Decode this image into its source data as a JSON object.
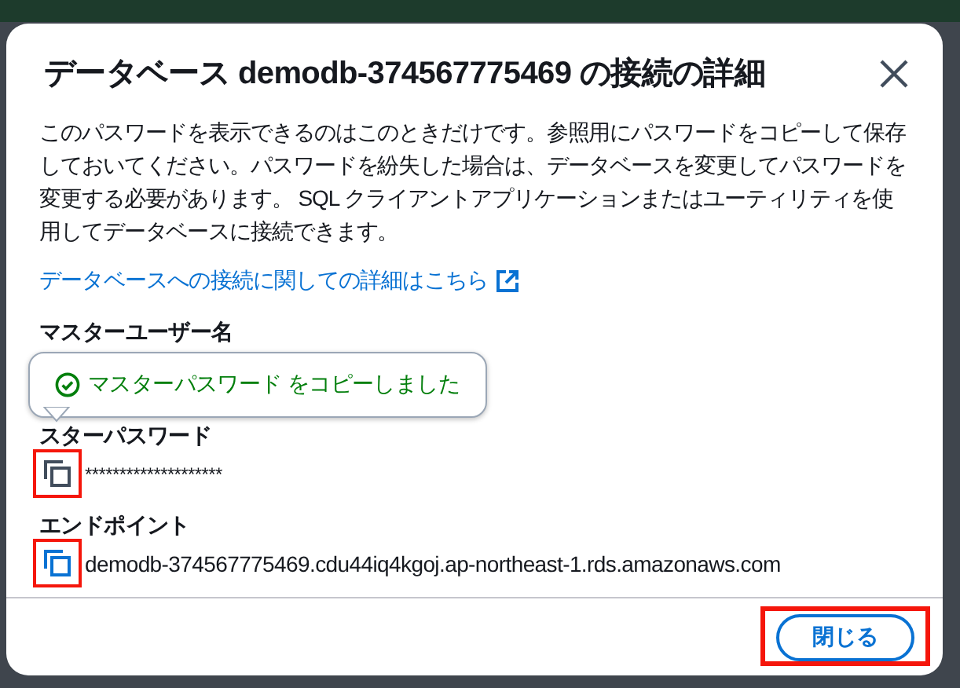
{
  "dialog": {
    "title": "データベース demodb-374567775469 の接続の詳細",
    "description": "このパスワードを表示できるのはこのときだけです。参照用にパスワードをコピーして保存しておいてください。パスワードを紛失した場合は、データベースを変更してパスワードを変更する必要があります。 SQL クライアントアプリケーションまたはユーティリティを使用してデータベースに接続できます。",
    "link": "データベースへの接続に関しての詳細はこちら",
    "fields": [
      {
        "label": "マスターユーザー名"
      },
      {
        "label": "スターパスワード",
        "value": "********************",
        "annotated": true,
        "focused": false
      },
      {
        "label": "エンドポイント",
        "value": "demodb-374567775469.cdu44iq4kgoj.ap-northeast-1.rds.amazonaws.com",
        "annotated": true,
        "focused": true
      }
    ],
    "tooltip": {
      "text": "マスターパスワード をコピーしました"
    },
    "close_button": {
      "label": "閉じる",
      "annotated": true
    }
  }
}
